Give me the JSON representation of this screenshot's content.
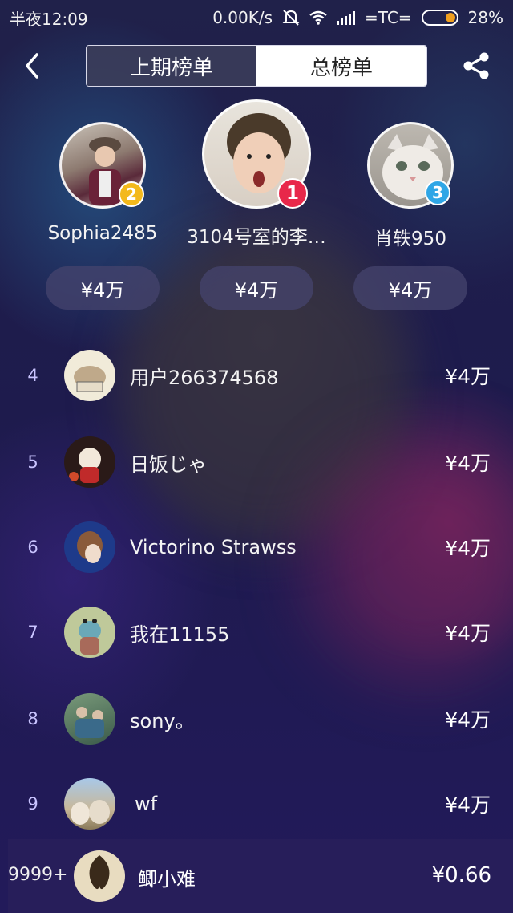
{
  "status_bar": {
    "time": "半夜12:09",
    "net_speed": "0.00K/s",
    "carrier": "=TC=",
    "battery": "28%"
  },
  "header": {
    "tabs": [
      {
        "label": "上期榜单",
        "active": false
      },
      {
        "label": "总榜单",
        "active": true
      }
    ],
    "back_icon": "chevron-left-icon",
    "share_icon": "share-icon"
  },
  "podium": [
    {
      "rank": "2",
      "name": "Sophia2485",
      "amount": "¥4万",
      "badge_color": "#f3b91c"
    },
    {
      "rank": "1",
      "name": "3104号室的李…",
      "amount": "¥4万",
      "badge_color": "#e8284a"
    },
    {
      "rank": "3",
      "name": "肖轶950",
      "amount": "¥4万",
      "badge_color": "#2fa6e6"
    }
  ],
  "list": [
    {
      "rank": "4",
      "name": "用户266374568",
      "amount": "¥4万"
    },
    {
      "rank": "5",
      "name": "日饭じゃ",
      "amount": "¥4万"
    },
    {
      "rank": "6",
      "name": "Victorino Strawss",
      "amount": "¥4万"
    },
    {
      "rank": "7",
      "name": "我在11155",
      "amount": "¥4万"
    },
    {
      "rank": "8",
      "name": "sony。",
      "amount": "¥4万"
    },
    {
      "rank": "9",
      "name": "wf",
      "amount": "¥4万"
    }
  ],
  "me": {
    "rank": "9999+",
    "name": "鲫小难",
    "amount": "¥0.66"
  }
}
